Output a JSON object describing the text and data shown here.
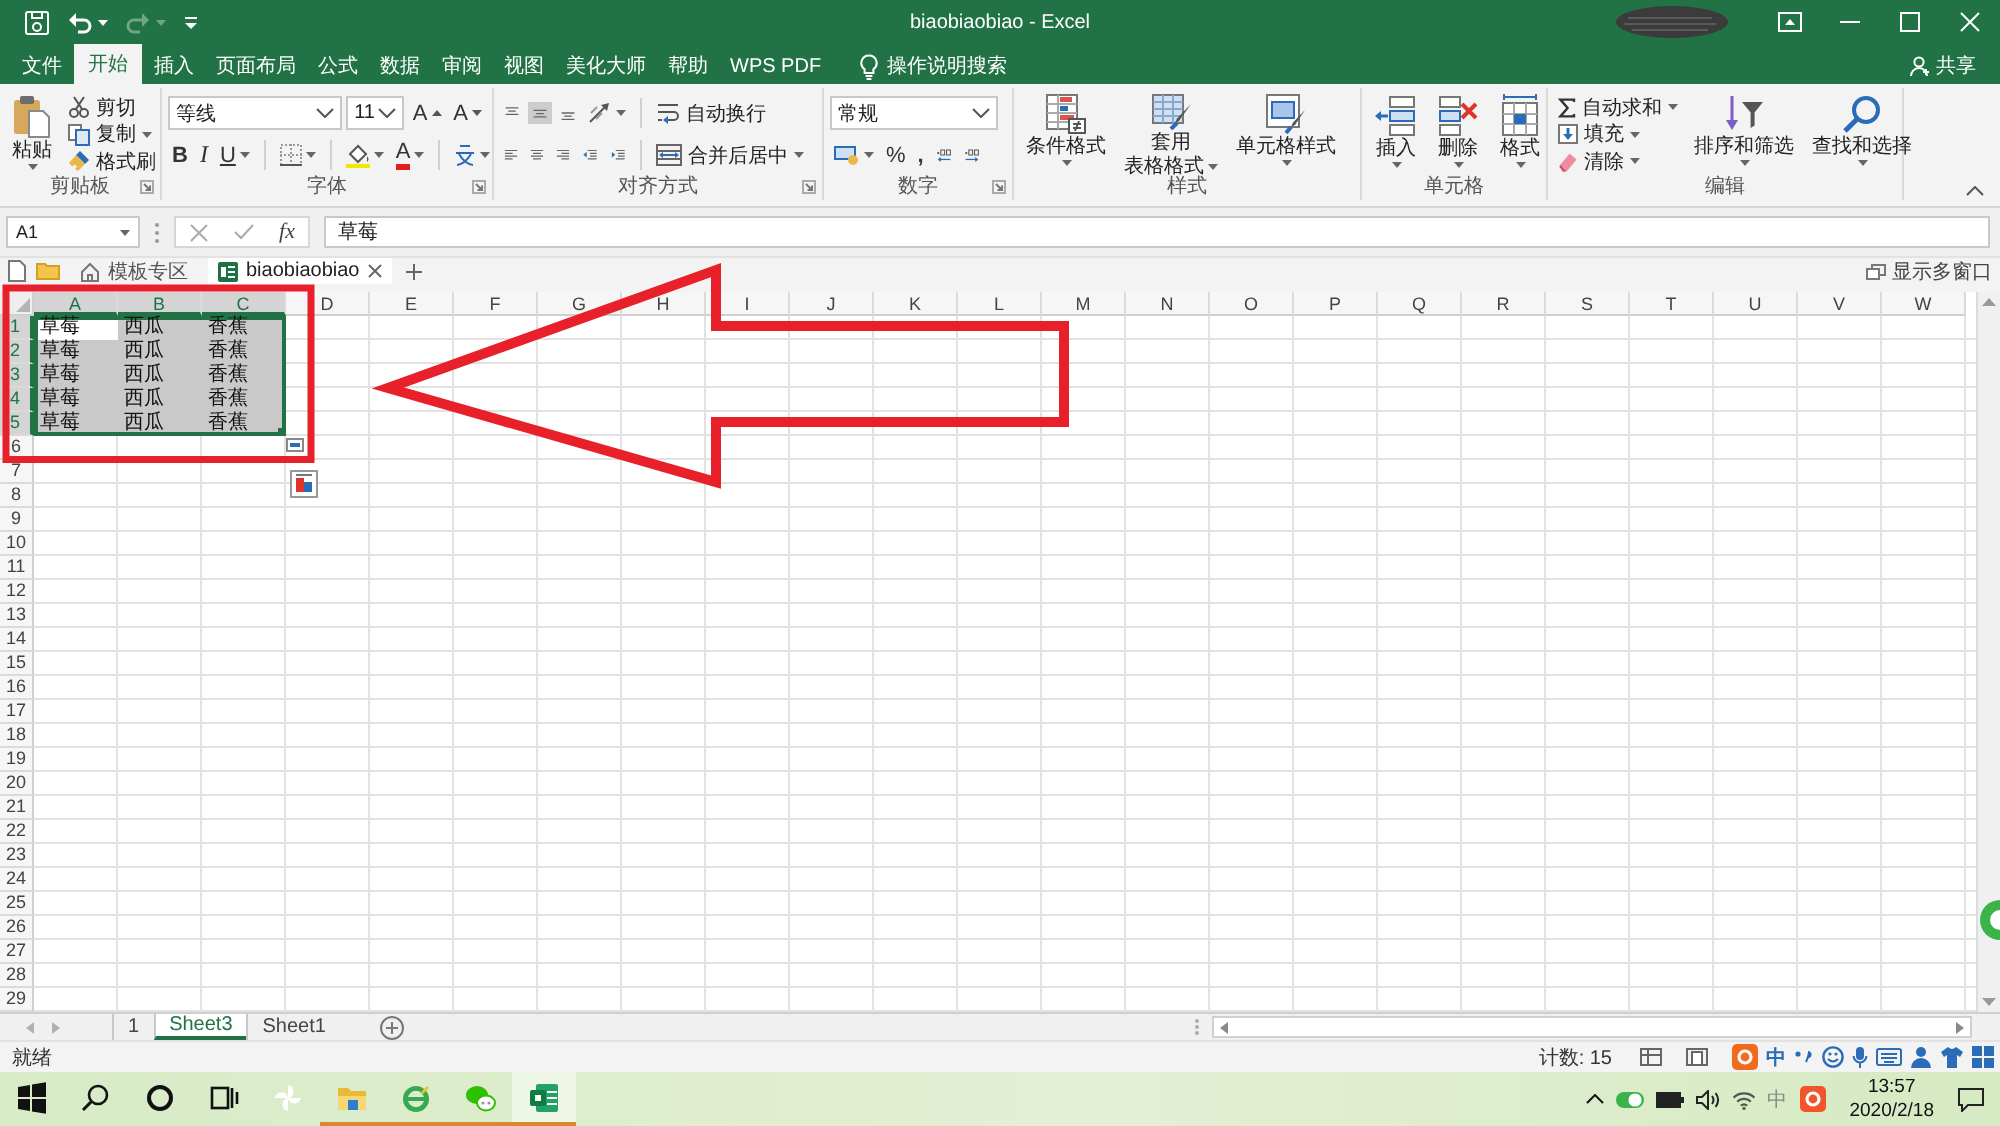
{
  "title_bar": {
    "title": "biaobiaobiao - Excel"
  },
  "ribbon_tabs": [
    {
      "label": "文件",
      "selected": false
    },
    {
      "label": "开始",
      "selected": true
    },
    {
      "label": "插入",
      "selected": false
    },
    {
      "label": "页面布局",
      "selected": false
    },
    {
      "label": "公式",
      "selected": false
    },
    {
      "label": "数据",
      "selected": false
    },
    {
      "label": "审阅",
      "selected": false
    },
    {
      "label": "视图",
      "selected": false
    },
    {
      "label": "美化大师",
      "selected": false
    },
    {
      "label": "帮助",
      "selected": false
    },
    {
      "label": "WPS PDF",
      "selected": false
    }
  ],
  "tell_me": {
    "placeholder": "操作说明搜索"
  },
  "share_button": {
    "label": "共享"
  },
  "ribbon": {
    "clipboard": {
      "label": "剪贴板",
      "paste": "粘贴",
      "cut": "剪切",
      "copy": "复制",
      "format_painter": "格式刷"
    },
    "font": {
      "label": "字体",
      "font_name": "等线",
      "font_size": "11",
      "grow": "A",
      "shrink": "A",
      "bold": "B",
      "italic": "I",
      "underline": "U",
      "font_color": "A"
    },
    "alignment": {
      "label": "对齐方式",
      "vertical": [
        {
          "kind": "top",
          "selected": false
        },
        {
          "kind": "middle",
          "selected": true
        },
        {
          "kind": "bottom",
          "selected": false
        }
      ],
      "wrap_text": "自动换行",
      "merge_center": "合并后居中"
    },
    "number": {
      "label": "数字",
      "format": "常规",
      "percent": "%",
      "comma": ","
    },
    "styles": {
      "label": "样式",
      "conditional_formatting": "条件格式",
      "format_as_table": [
        "套用",
        "表格格式"
      ],
      "cell_styles": "单元格样式"
    },
    "cells": {
      "label": "单元格",
      "buttons": [
        "插入",
        "删除",
        "格式"
      ]
    },
    "editing": {
      "label": "编辑",
      "autosum": "自动求和",
      "fill": "填充",
      "clear": "清除",
      "sort_filter": "排序和筛选",
      "find_select": "查找和选择"
    }
  },
  "formula_bar": {
    "name_box": "A1",
    "function_button": "fx",
    "formula": "草莓"
  },
  "document_tabs": {
    "tabs": [
      {
        "label": "模板专区",
        "selected": false
      },
      {
        "label": "biaobiaobiao",
        "selected": true
      }
    ],
    "multi_window": "显示多窗口"
  },
  "sheet": {
    "columns": [
      {
        "label": "A",
        "selected": true
      },
      {
        "label": "B",
        "selected": true
      },
      {
        "label": "C",
        "selected": true
      },
      {
        "label": "D",
        "selected": false
      },
      {
        "label": "E",
        "selected": false
      },
      {
        "label": "F",
        "selected": false
      },
      {
        "label": "G",
        "selected": false
      },
      {
        "label": "H",
        "selected": false
      },
      {
        "label": "I",
        "selected": false
      },
      {
        "label": "J",
        "selected": false
      },
      {
        "label": "K",
        "selected": false
      },
      {
        "label": "L",
        "selected": false
      },
      {
        "label": "M",
        "selected": false
      },
      {
        "label": "N",
        "selected": false
      },
      {
        "label": "O",
        "selected": false
      },
      {
        "label": "P",
        "selected": false
      },
      {
        "label": "Q",
        "selected": false
      },
      {
        "label": "R",
        "selected": false
      },
      {
        "label": "S",
        "selected": false
      },
      {
        "label": "T",
        "selected": false
      },
      {
        "label": "U",
        "selected": false
      },
      {
        "label": "V",
        "selected": false
      },
      {
        "label": "W",
        "selected": false
      }
    ],
    "rows": [
      {
        "label": "1",
        "selected": true,
        "cells": [
          {
            "text": "草莓",
            "selected": true,
            "active": true
          },
          {
            "text": "西瓜",
            "selected": true,
            "active": false
          },
          {
            "text": "香蕉",
            "selected": true,
            "active": false
          }
        ]
      },
      {
        "label": "2",
        "selected": true,
        "cells": [
          {
            "text": "草莓",
            "selected": true,
            "active": false
          },
          {
            "text": "西瓜",
            "selected": true,
            "active": false
          },
          {
            "text": "香蕉",
            "selected": true,
            "active": false
          }
        ]
      },
      {
        "label": "3",
        "selected": true,
        "cells": [
          {
            "text": "草莓",
            "selected": true,
            "active": false
          },
          {
            "text": "西瓜",
            "selected": true,
            "active": false
          },
          {
            "text": "香蕉",
            "selected": true,
            "active": false
          }
        ]
      },
      {
        "label": "4",
        "selected": true,
        "cells": [
          {
            "text": "草莓",
            "selected": true,
            "active": false
          },
          {
            "text": "西瓜",
            "selected": true,
            "active": false
          },
          {
            "text": "香蕉",
            "selected": true,
            "active": false
          }
        ]
      },
      {
        "label": "5",
        "selected": true,
        "cells": [
          {
            "text": "草莓",
            "selected": true,
            "active": false
          },
          {
            "text": "西瓜",
            "selected": true,
            "active": false
          },
          {
            "text": "香蕉",
            "selected": true,
            "active": false
          }
        ]
      },
      {
        "label": "6",
        "selected": false
      },
      {
        "label": "7",
        "selected": false
      },
      {
        "label": "8",
        "selected": false
      },
      {
        "label": "9",
        "selected": false
      },
      {
        "label": "10",
        "selected": false
      },
      {
        "label": "11",
        "selected": false
      },
      {
        "label": "12",
        "selected": false
      },
      {
        "label": "13",
        "selected": false
      },
      {
        "label": "14",
        "selected": false
      },
      {
        "label": "15",
        "selected": false
      },
      {
        "label": "16",
        "selected": false
      },
      {
        "label": "17",
        "selected": false
      },
      {
        "label": "18",
        "selected": false
      },
      {
        "label": "19",
        "selected": false
      },
      {
        "label": "20",
        "selected": false
      },
      {
        "label": "21",
        "selected": false
      },
      {
        "label": "22",
        "selected": false
      },
      {
        "label": "23",
        "selected": false
      },
      {
        "label": "24",
        "selected": false
      },
      {
        "label": "25",
        "selected": false
      },
      {
        "label": "26",
        "selected": false
      },
      {
        "label": "27",
        "selected": false
      },
      {
        "label": "28",
        "selected": false
      },
      {
        "label": "29",
        "selected": false
      }
    ]
  },
  "sheet_tabs": [
    {
      "label": "1",
      "selected": false
    },
    {
      "label": "Sheet3",
      "selected": true
    },
    {
      "label": "Sheet1",
      "selected": false
    }
  ],
  "status_bar": {
    "status": "就绪",
    "count": "计数: 15"
  },
  "ime_toolbar": {
    "mode": "中"
  },
  "taskbar": {
    "apps": [
      {
        "kind": "start",
        "running": false,
        "selected": false
      },
      {
        "kind": "search",
        "running": false,
        "selected": false
      },
      {
        "kind": "cortana",
        "running": false,
        "selected": false
      },
      {
        "kind": "task-view",
        "running": false,
        "selected": false
      },
      {
        "kind": "pinwheel",
        "running": false,
        "selected": false
      },
      {
        "kind": "explorer",
        "running": true,
        "selected": false
      },
      {
        "kind": "ie",
        "running": true,
        "selected": false
      },
      {
        "kind": "wechat",
        "running": true,
        "selected": false
      },
      {
        "kind": "excel",
        "running": true,
        "selected": true
      }
    ],
    "tray": {
      "ime": "中",
      "time": "13:57",
      "date": "2020/2/18"
    }
  },
  "annotations": {
    "highlight_frame": true,
    "arrow": true
  }
}
